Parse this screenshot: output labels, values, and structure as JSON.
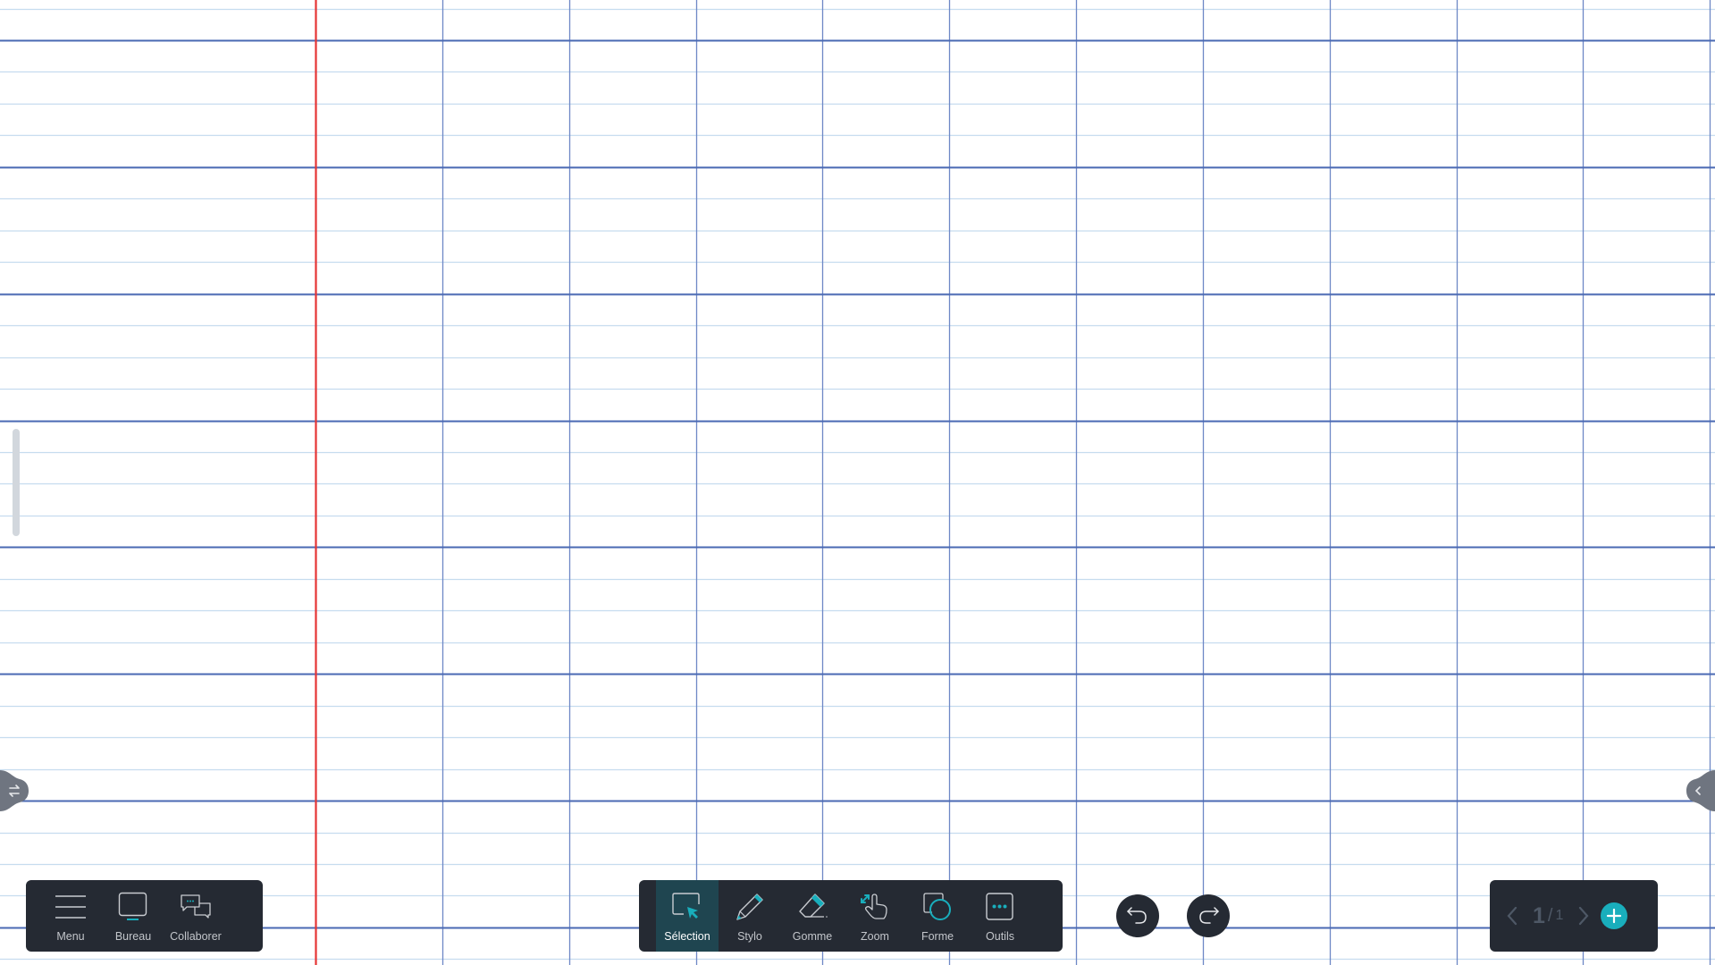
{
  "canvas": {
    "paper": "seyes-ruled",
    "colors": {
      "background": "#ffffff",
      "major_line": "#4a69b3",
      "minor_line": "#c6dcef",
      "vertical_line": "#6e88c6",
      "margin_line": "#e53535"
    }
  },
  "left_menu": {
    "items": [
      {
        "id": "menu",
        "label": "Menu",
        "icon": "hamburger-icon"
      },
      {
        "id": "bureau",
        "label": "Bureau",
        "icon": "monitor-icon"
      },
      {
        "id": "collaborer",
        "label": "Collaborer",
        "icon": "chat-bubbles-icon"
      }
    ]
  },
  "toolbar": {
    "active": "selection",
    "accent": "#19aebc",
    "items": [
      {
        "id": "selection",
        "label": "Sélection",
        "icon": "selection-cursor-icon"
      },
      {
        "id": "stylo",
        "label": "Stylo",
        "icon": "pen-icon"
      },
      {
        "id": "gomme",
        "label": "Gomme",
        "icon": "eraser-icon"
      },
      {
        "id": "zoom",
        "label": "Zoom",
        "icon": "pinch-zoom-hand-icon"
      },
      {
        "id": "forme",
        "label": "Forme",
        "icon": "shapes-icon"
      },
      {
        "id": "outils",
        "label": "Outils",
        "icon": "more-tools-icon"
      }
    ]
  },
  "history": {
    "undo_icon": "undo-icon",
    "redo_icon": "redo-icon"
  },
  "pagination": {
    "current": "1",
    "separator": "/",
    "total": "1",
    "prev_icon": "chevron-left-icon",
    "next_icon": "chevron-right-icon",
    "add_icon": "plus-icon"
  },
  "edge_tabs": {
    "left_icon": "swap-arrows-icon",
    "right_icon": "chevron-left-icon"
  }
}
